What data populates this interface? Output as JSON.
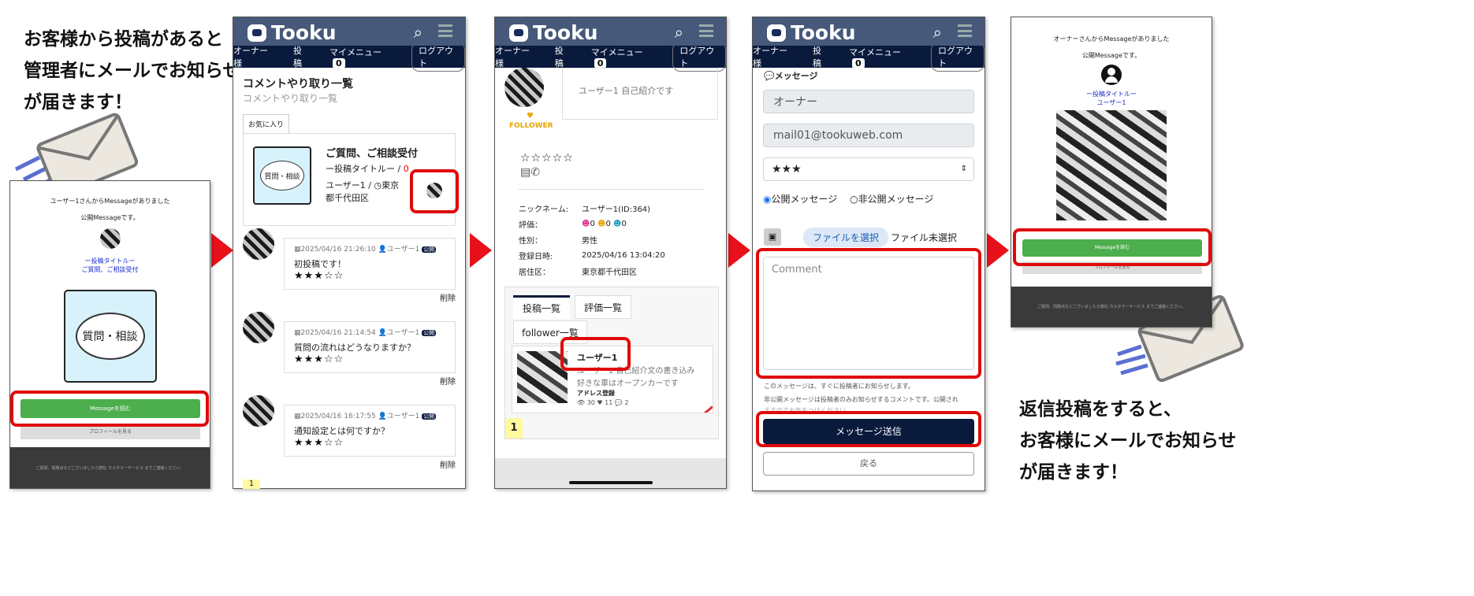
{
  "captions": {
    "top_left": [
      "お客様から投稿があると",
      "管理者にメールでお知らせ",
      "が届きます！"
    ],
    "bottom_right": [
      "返信投稿をすると、",
      "お客様にメールでお知らせ",
      "が届きます！"
    ]
  },
  "app": {
    "name": "Tooku",
    "nav": {
      "owner": "オーナー様",
      "post": "投稿",
      "my_menu": "マイメニュー",
      "badge": "0",
      "logout": "ログアウト"
    }
  },
  "email1": {
    "line1": "ユーザー1さんからMessageがありました",
    "line2": "公開Messageです。",
    "title_line1": "ー投稿タイトルー",
    "title_line2": "ご質問、ご相談受付",
    "image_text": "質問・相談",
    "read_button": "Messageを読む",
    "profile_button": "プロフィールを見る",
    "footer": "ご質問、問題点などございましたら弊社 カスタマーサービス までご連絡ください。"
  },
  "screen2": {
    "heading": "コメントやり取り一覧",
    "subheading": "コメントやり取り一覧",
    "tab_favorite": "お気に入り",
    "post_title": "ご質問、ご相談受付",
    "post_subtitle": "ー投稿タイトルー",
    "post_sep": "/",
    "post_count": "0",
    "post_thumb_text": "質問・相談",
    "post_user": "ユーザー1",
    "post_loc_sep": "/",
    "post_location_1": "東京",
    "post_location_2": "都千代田区",
    "comments": [
      {
        "date": "2025/04/16 21:26:10",
        "user": "ユーザー1",
        "badge": "公開",
        "text": "初投稿です！",
        "stars": "★★★☆☆",
        "delete": "削除"
      },
      {
        "date": "2025/04/16 21:14:54",
        "user": "ユーザー1",
        "badge": "公開",
        "text": "質問の流れはどうなりますか？",
        "stars": "★★★☆☆",
        "delete": "削除"
      },
      {
        "date": "2025/04/16 16:17:55",
        "user": "ユーザー1",
        "badge": "公開",
        "text": "通知設定とは何ですか？",
        "stars": "★★★☆☆",
        "delete": "削除"
      }
    ],
    "page": "1"
  },
  "screen3": {
    "bio": "ユーザー1 自己紹介です",
    "follower": "FOLLOWER",
    "rating_stars": "☆☆☆☆☆",
    "labels": {
      "nickname": "ニックネーム:",
      "rating": "評価：",
      "gender": "性別：",
      "registered": "登録日時:",
      "area": "居住区："
    },
    "values": {
      "nickname": "ユーザー1(ID:364)",
      "r1": "0",
      "r2": "0",
      "r3": "0",
      "gender": "男性",
      "registered": "2025/04/16 13:04:20",
      "area": "東京都千代田区"
    },
    "tabs": [
      "投稿一覧",
      "評価一覧",
      "follower一覧"
    ],
    "card": {
      "user": "ユーザー1",
      "desc1": "ユーザー1 自己紹介文の書き込み",
      "desc2": "好きな車はオープンカーです",
      "address": "アドレス登録",
      "views": "30",
      "likes": "11",
      "comments": "2"
    },
    "page": "1"
  },
  "screen4": {
    "section_title": "メッセージ",
    "owner_field": "オーナー",
    "email_field": "mail01@tookuweb.com",
    "select_value": "★★★",
    "radio_public": "公開メッセージ",
    "radio_private": "非公開メッセージ",
    "file_button": "ファイルを選択",
    "file_status": "ファイル未選択",
    "comment_placeholder": "Comment",
    "note1": "このメッセージは、すぐに投稿者にお知らせします。",
    "note2": "非公開メッセージは投稿者のみお知らせするコメントです。公開され",
    "note3": "ますのでお気をつけください",
    "send_button": "メッセージ送信",
    "back_button": "戻る"
  },
  "email2": {
    "line1": "オーナーさんからMessageがありました",
    "line2": "公開Messageです。",
    "title_line1": "ー投稿タイトルー",
    "title_line2": "ユーザー1",
    "read_button": "Messageを読む",
    "profile_button": "プロフィールを見る",
    "footer": "ご質問、問題点などございましたら弊社 カスタマーサービス までご連絡ください。"
  }
}
